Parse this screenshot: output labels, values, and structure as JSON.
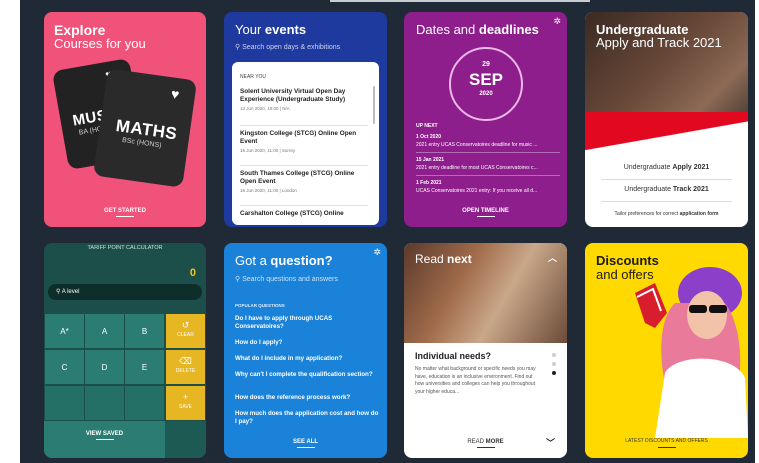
{
  "explore": {
    "title": "Explore",
    "subtitle": "Courses for you",
    "book1": {
      "big": "MUSI",
      "small": "BA (HONS)"
    },
    "book2": {
      "big": "MATHS",
      "small": "BSc (HONS)"
    },
    "cta": "GET STARTED"
  },
  "events": {
    "title_a": "Your ",
    "title_b": "events",
    "search_placeholder": "Search open days & exhibitions",
    "near_label": "NEAR YOU",
    "items": [
      {
        "name": "Solent University Virtual Open Day Experience (Undergraduate Study)",
        "meta": "13 Jun 2020, 10:00 | N/A"
      },
      {
        "name": "Kingston College (STCG) Online Open Event",
        "meta": "16 Jun 2020, 11:00 | Surrey"
      },
      {
        "name": "South Thames College (STCG) Online Open Event",
        "meta": "16 Jun 2020, 11:00 | London"
      },
      {
        "name": "Carshalton College (STCG) Online",
        "meta": ""
      }
    ]
  },
  "dates": {
    "title_a": "Dates and ",
    "title_b": "deadlines",
    "day": "29",
    "month": "SEP",
    "year": "2020",
    "up_next": "UP NEXT",
    "items": [
      {
        "date": "1 Oct 2020",
        "text": "2021 entry UCAS Conservatoires deadline for music ..."
      },
      {
        "date": "15 Jan 2021",
        "text": "2021 entry deadline for most UCAS Conservatoires c..."
      },
      {
        "date": "1 Feb 2021",
        "text": "UCAS Conservatoires 2021 entry: If you receive all d..."
      }
    ],
    "cta": "OPEN TIMELINE"
  },
  "undergrad": {
    "title": "Undergraduate",
    "subtitle": "Apply and Track 2021",
    "apply_a": "Undergraduate ",
    "apply_b": "Apply 2021",
    "track_a": "Undergraduate ",
    "track_b": "Track 2021",
    "tailor_a": "Tailor preferences for correct ",
    "tailor_b": "application form"
  },
  "tariff": {
    "title": "TARIFF POINT CALCULATOR",
    "value": "0",
    "search_value": "A level",
    "grades": [
      "A*",
      "A",
      "B",
      "C",
      "D",
      "E"
    ],
    "actions": [
      {
        "label": "CLEAR",
        "icon": "↺"
      },
      {
        "label": "DELETE",
        "icon": "⌫"
      },
      {
        "label": "SAVE",
        "icon": "+"
      }
    ],
    "view_saved": "VIEW SAVED"
  },
  "question": {
    "title_a": "Got a ",
    "title_b": "question?",
    "search_placeholder": "Search questions and answers",
    "popular_label": "POPULAR QUESTIONS",
    "items": [
      "Do I have to apply through UCAS Conservatoires?",
      "How do I apply?",
      "What do I include in my application?",
      "Why can't I complete the qualification section?",
      "How does the reference process work?",
      "How much does the application cost and how do I pay?"
    ],
    "cta": "SEE ALL"
  },
  "readnext": {
    "title_a": "Read ",
    "title_b": "next",
    "heading": "Individual needs?",
    "body": "No matter what background or specific needs you may have, education is an inclusive environment. Find out how universities and colleges can help you throughout your higher educa...",
    "cta_a": "READ ",
    "cta_b": "MORE"
  },
  "discounts": {
    "title": "Discounts",
    "subtitle": "and offers",
    "cta": "LATEST DISCOUNTS AND OFFERS"
  },
  "colors": {
    "page_bg": "#202a36",
    "explore": "#f0527a",
    "events": "#1f3a9e",
    "dates": "#8d1e8c",
    "tariff": "#1c4f4a",
    "question": "#1b82d9",
    "discounts": "#ffd900",
    "ucas_red": "#e1081f"
  }
}
